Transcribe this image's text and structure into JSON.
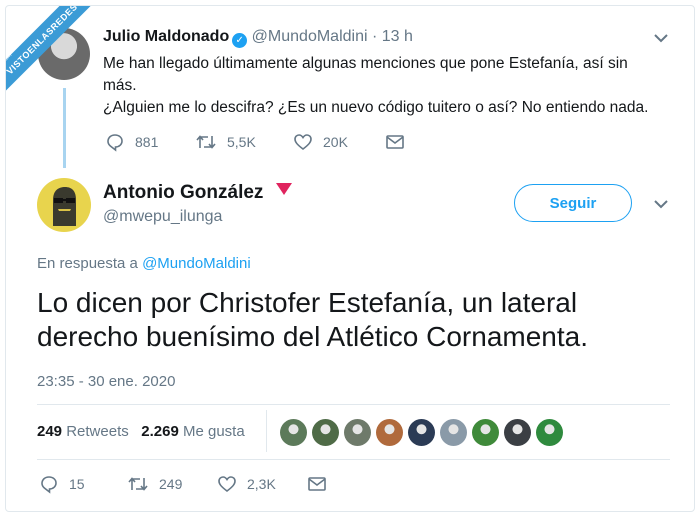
{
  "watermark": {
    "text": "VISTOENLASREDES",
    "subtext": ".com"
  },
  "tweet1": {
    "name": "Julio Maldonado",
    "handle": "@MundoMaldini",
    "time": "· 13 h",
    "lines": [
      "Me han llegado últimamente algunas menciones que pone Estefanía, así sin más.",
      "¿Alguien me lo descifra? ¿Es un nuevo código tuitero o así? No entiendo nada."
    ],
    "replies": "881",
    "retweets": "5,5K",
    "likes": "20K"
  },
  "tweet2": {
    "name": "Antonio González",
    "handle": "@mwepu_ilunga",
    "follow_label": "Seguir",
    "reply_prefix": "En respuesta a",
    "reply_handle": "@MundoMaldini",
    "text": "Lo dicen por Christofer Estefanía, un lateral derecho buenísimo del Atlético Cornamenta.",
    "timestamp": "23:35 - 30 ene. 2020",
    "retweet_count": "249",
    "retweet_label": "Retweets",
    "like_count": "2.269",
    "like_label": "Me gusta",
    "likers": [
      "#5c7a5a",
      "#4f6b47",
      "#6e7a6a",
      "#b06a3c",
      "#2b3b55",
      "#8a9aa8",
      "#3f8a3a",
      "#3b3f44",
      "#2f8a3e"
    ],
    "replies": "15",
    "retweets": "249",
    "likes": "2,3K"
  },
  "colors": {
    "accent": "#1da1f2",
    "muted": "#657786",
    "heart_flag": "#e0245e"
  }
}
